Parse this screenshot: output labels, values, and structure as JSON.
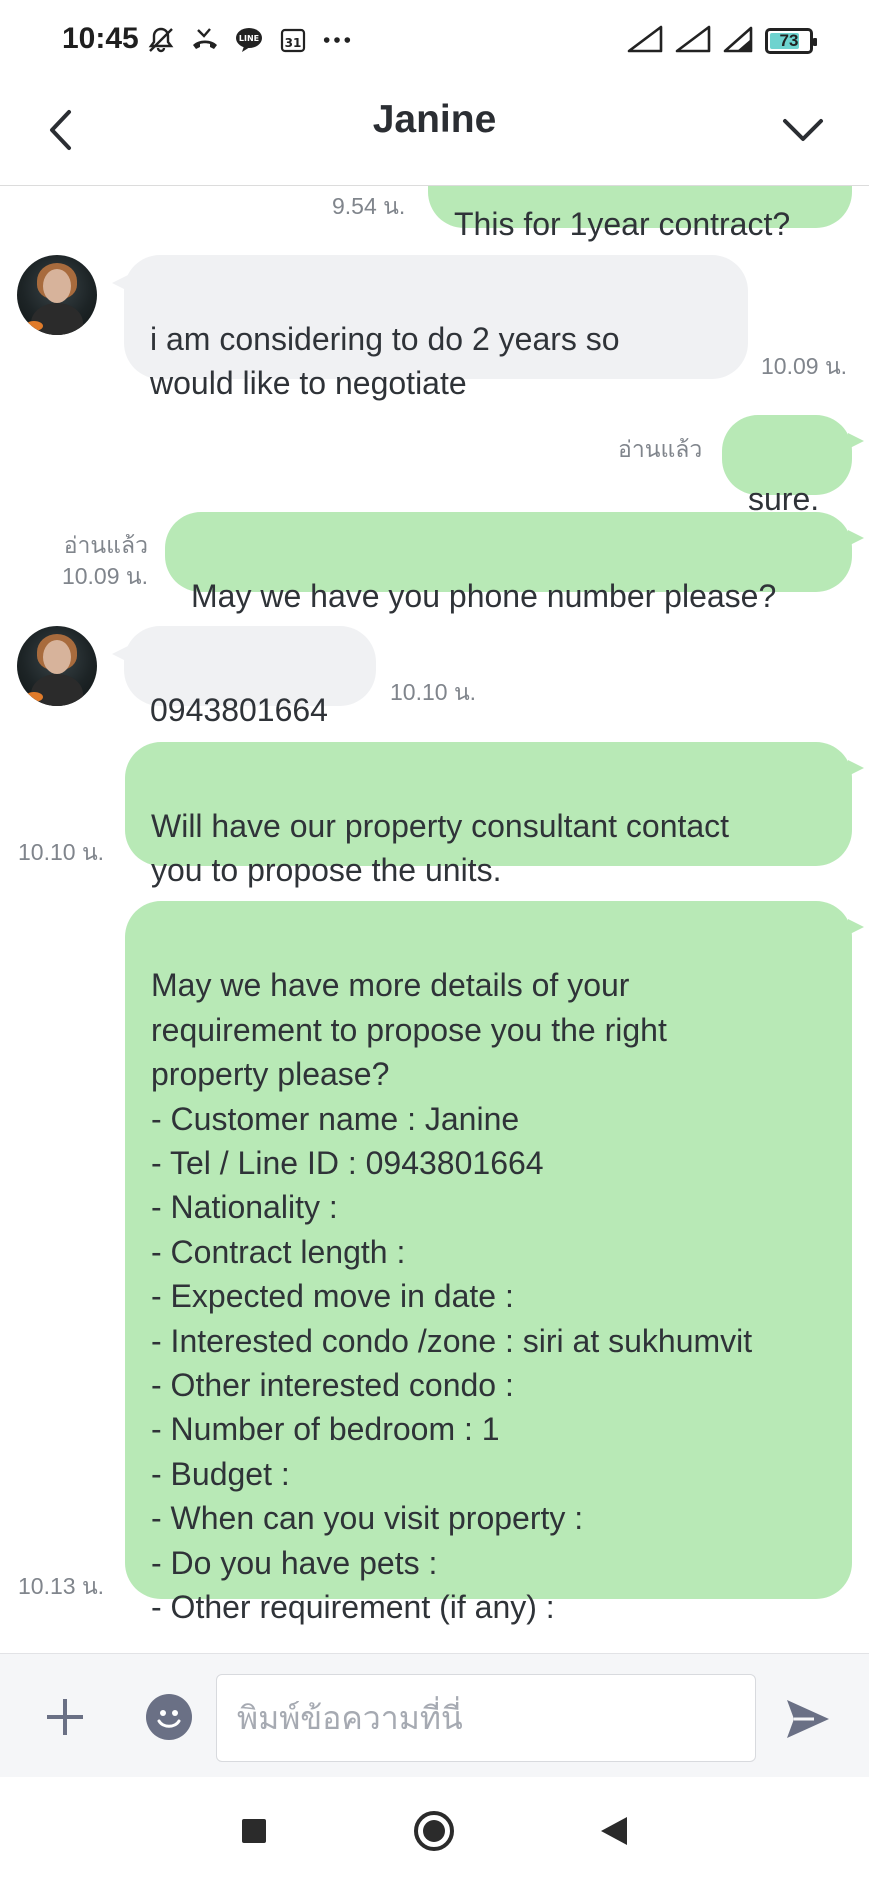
{
  "status_bar": {
    "time": "10:45",
    "battery_level": "73",
    "battery_fraction": 0.73,
    "icons": [
      "notifications-off-icon",
      "missed-call-icon",
      "line-app-icon",
      "calendar-icon",
      "more-dots-icon",
      "signal-icon",
      "signal-icon",
      "wifi-icon",
      "battery-icon"
    ],
    "calendar_day": "31",
    "line_label": "LINE"
  },
  "header": {
    "title": "Janine"
  },
  "messages": [
    {
      "id": "m0",
      "direction": "out",
      "text": "This for 1year contract?",
      "time": "9.54 น.",
      "read": ""
    },
    {
      "id": "m1",
      "direction": "in",
      "text": "i am considering to do 2 years so\nwould like to negotiate",
      "time": "10.09 น."
    },
    {
      "id": "m2",
      "direction": "out",
      "text": "sure.",
      "time": "",
      "read": "อ่านแล้ว"
    },
    {
      "id": "m3",
      "direction": "out",
      "text": "May we have you phone number please?",
      "time": "10.09 น.",
      "read": "อ่านแล้ว"
    },
    {
      "id": "m4",
      "direction": "in",
      "text": "0943801664",
      "time": "10.10 น."
    },
    {
      "id": "m5",
      "direction": "out",
      "text": "Will have our property consultant contact\nyou to propose the units.",
      "time": "10.10 น.",
      "read": ""
    },
    {
      "id": "m6",
      "direction": "out",
      "text": "May we have more details of your\nrequirement to propose you the right\nproperty please?\n- Customer name : Janine\n- Tel / Line ID : 0943801664\n- Nationality :\n- Contract length :\n- Expected move in date :\n- Interested condo /zone : siri at sukhumvit\n- Other interested condo :\n- Number of bedroom  : 1\n- Budget :\n- When can you visit property :\n- Do you have pets :\n- Other requirement (if any) :",
      "time": "10.13 น.",
      "read": ""
    }
  ],
  "input": {
    "placeholder": "พิมพ์ข้อความที่นี่",
    "value": ""
  },
  "colors": {
    "outgoing_bubble": "#b8e9b6",
    "incoming_bubble": "#f0f1f3",
    "accent_icon": "#6a7085"
  }
}
